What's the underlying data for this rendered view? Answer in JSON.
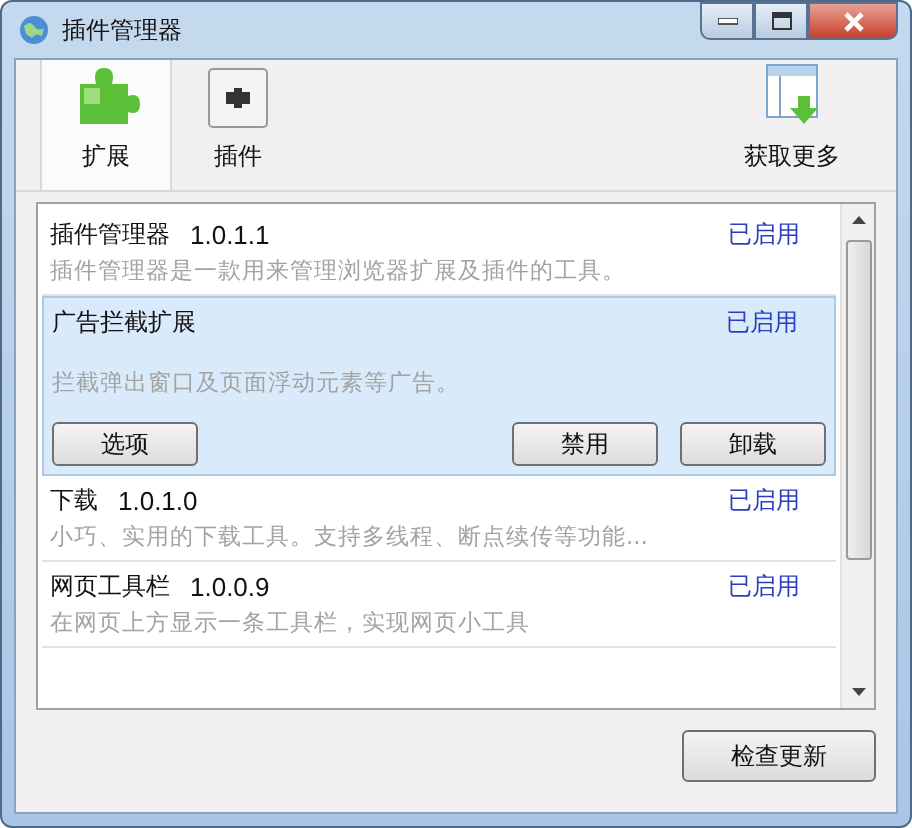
{
  "window": {
    "title": "插件管理器"
  },
  "tabs": [
    {
      "label": "扩展",
      "kind": "puzzle",
      "selected": true
    },
    {
      "label": "插件",
      "kind": "plugin",
      "selected": false
    }
  ],
  "get_more": {
    "label": "获取更多"
  },
  "items": [
    {
      "name": "插件管理器",
      "version": "1.0.1.1",
      "description": "插件管理器是一款用来管理浏览器扩展及插件的工具。",
      "status": "已启用",
      "selected": false
    },
    {
      "name": "广告拦截扩展",
      "description": "拦截弹出窗口及页面浮动元素等广告。",
      "status": "已启用",
      "selected": true,
      "buttons": [
        "选项",
        "禁用",
        "卸载"
      ]
    },
    {
      "name": "下载",
      "version": "1.0.1.0",
      "description": "小巧、实用的下载工具。支持多线程、断点续传等功能...",
      "status": "已启用",
      "selected": false
    },
    {
      "name": "网页工具栏",
      "version": "1.0.0.9",
      "description": "在网页上方显示一条工具栏，实现网页小工具",
      "status": "已启用",
      "selected": false
    }
  ],
  "footer_button": "检查更新"
}
